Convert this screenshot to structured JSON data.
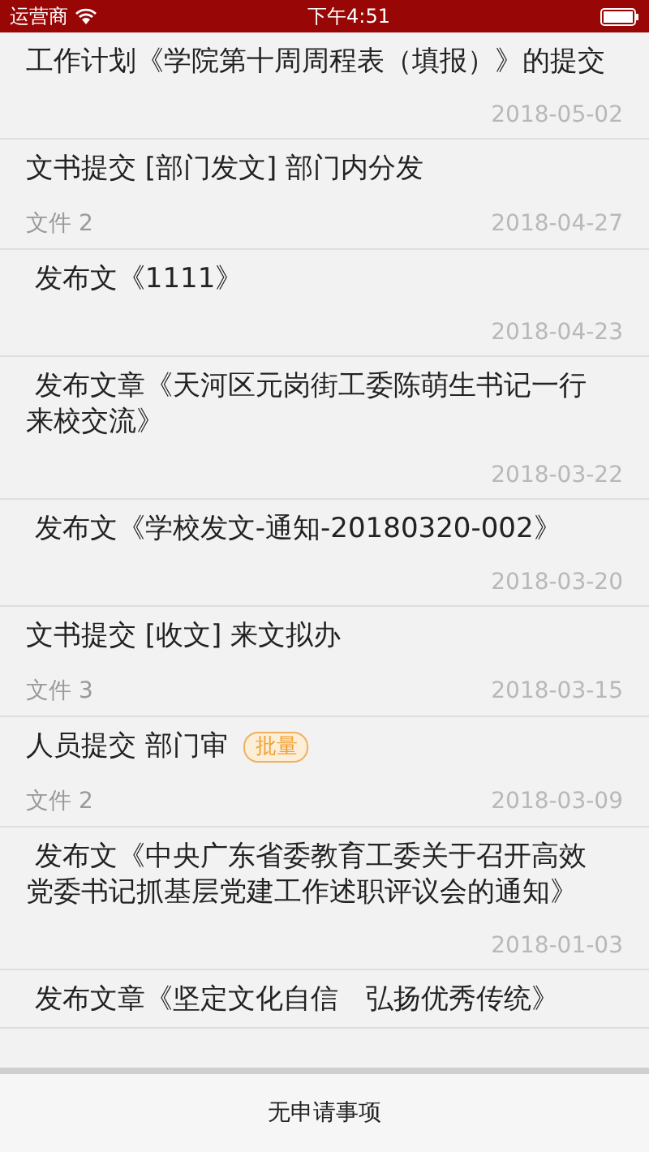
{
  "status_bar": {
    "carrier": "运营商",
    "time": "下午4:51"
  },
  "items": [
    {
      "title": "工作计划《学院第十周周程表（填报）》的提交",
      "date": "2018-05-02"
    },
    {
      "title": "文书提交 [部门发文] 部门内分发",
      "subtitle": "文件 2",
      "date": "2018-04-27"
    },
    {
      "title": " 发布文《1111》",
      "date": "2018-04-23"
    },
    {
      "title": " 发布文章《天河区元岗街工委陈萌生书记一行来校交流》",
      "date": "2018-03-22"
    },
    {
      "title": " 发布文《学校发文-通知-20180320-002》",
      "date": "2018-03-20"
    },
    {
      "title": "文书提交 [收文] 来文拟办",
      "subtitle": "文件 3",
      "date": "2018-03-15"
    },
    {
      "title": "人员提交 部门审",
      "badge": "批量",
      "subtitle": "文件 2",
      "date": "2018-03-09"
    },
    {
      "title": " 发布文《中央广东省委教育工委关于召开高效党委书记抓基层党建工作述职评议会的通知》",
      "date": "2018-01-03"
    },
    {
      "title": " 发布文章《坚定文化自信　弘扬优秀传统》"
    }
  ],
  "footer": {
    "message": "无申请事项"
  }
}
